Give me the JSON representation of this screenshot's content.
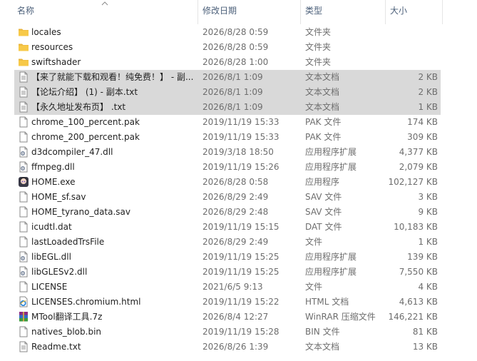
{
  "columns": {
    "name": "名称",
    "modified": "修改日期",
    "type": "类型",
    "size": "大小"
  },
  "files": [
    {
      "name": "locales",
      "modified": "2026/8/28 0:59",
      "type": "文件夹",
      "size": "",
      "icon": "folder-icon",
      "selected": false
    },
    {
      "name": "resources",
      "modified": "2026/8/28 0:59",
      "type": "文件夹",
      "size": "",
      "icon": "folder-icon",
      "selected": false
    },
    {
      "name": "swiftshader",
      "modified": "2026/8/28 1:00",
      "type": "文件夹",
      "size": "",
      "icon": "folder-icon",
      "selected": false
    },
    {
      "name": "【来了就能下载和观看！纯免费！】 - 副...",
      "modified": "2026/8/1 1:09",
      "type": "文本文档",
      "size": "2 KB",
      "icon": "text-file-icon",
      "selected": true
    },
    {
      "name": "【论坛介绍】 (1) - 副本.txt",
      "modified": "2026/8/1 1:09",
      "type": "文本文档",
      "size": "2 KB",
      "icon": "text-file-icon",
      "selected": true
    },
    {
      "name": "【永久地址发布页】 .txt",
      "modified": "2026/8/1 1:09",
      "type": "文本文档",
      "size": "1 KB",
      "icon": "text-file-icon",
      "selected": true
    },
    {
      "name": "chrome_100_percent.pak",
      "modified": "2019/11/19 15:33",
      "type": "PAK 文件",
      "size": "174 KB",
      "icon": "file-icon",
      "selected": false
    },
    {
      "name": "chrome_200_percent.pak",
      "modified": "2019/11/19 15:33",
      "type": "PAK 文件",
      "size": "309 KB",
      "icon": "file-icon",
      "selected": false
    },
    {
      "name": "d3dcompiler_47.dll",
      "modified": "2019/3/18 18:50",
      "type": "应用程序扩展",
      "size": "4,377 KB",
      "icon": "dll-icon",
      "selected": false
    },
    {
      "name": "ffmpeg.dll",
      "modified": "2019/11/19 15:26",
      "type": "应用程序扩展",
      "size": "2,079 KB",
      "icon": "dll-icon",
      "selected": false
    },
    {
      "name": "HOME.exe",
      "modified": "2026/8/28 0:58",
      "type": "应用程序",
      "size": "102,127 KB",
      "icon": "app-exe-icon",
      "selected": false
    },
    {
      "name": "HOME_sf.sav",
      "modified": "2026/8/29 2:49",
      "type": "SAV 文件",
      "size": "3 KB",
      "icon": "file-icon",
      "selected": false
    },
    {
      "name": "HOME_tyrano_data.sav",
      "modified": "2026/8/29 2:48",
      "type": "SAV 文件",
      "size": "9 KB",
      "icon": "file-icon",
      "selected": false
    },
    {
      "name": "icudtl.dat",
      "modified": "2019/11/19 15:15",
      "type": "DAT 文件",
      "size": "10,183 KB",
      "icon": "file-icon",
      "selected": false
    },
    {
      "name": "lastLoadedTrsFile",
      "modified": "2026/8/29 2:49",
      "type": "文件",
      "size": "1 KB",
      "icon": "file-icon",
      "selected": false
    },
    {
      "name": "libEGL.dll",
      "modified": "2019/11/19 15:25",
      "type": "应用程序扩展",
      "size": "139 KB",
      "icon": "dll-icon",
      "selected": false
    },
    {
      "name": "libGLESv2.dll",
      "modified": "2019/11/19 15:25",
      "type": "应用程序扩展",
      "size": "7,550 KB",
      "icon": "dll-icon",
      "selected": false
    },
    {
      "name": "LICENSE",
      "modified": "2021/6/5 9:13",
      "type": "文件",
      "size": "4 KB",
      "icon": "file-icon",
      "selected": false
    },
    {
      "name": "LICENSES.chromium.html",
      "modified": "2019/11/19 15:22",
      "type": "HTML 文档",
      "size": "4,613 KB",
      "icon": "ie-html-icon",
      "selected": false
    },
    {
      "name": "MTool翻译工具.7z",
      "modified": "2026/8/4 12:27",
      "type": "WinRAR 压缩文件",
      "size": "146,221 KB",
      "icon": "winrar-archive-icon",
      "selected": false
    },
    {
      "name": "natives_blob.bin",
      "modified": "2019/11/19 15:28",
      "type": "BIN 文件",
      "size": "81 KB",
      "icon": "file-icon",
      "selected": false
    },
    {
      "name": "Readme.txt",
      "modified": "2026/8/26 1:39",
      "type": "文本文档",
      "size": "13 KB",
      "icon": "text-file-icon",
      "selected": false
    }
  ],
  "colors": {
    "selected_row": "#d9d9d9",
    "folder": "#f7c948",
    "header_text": "#4c607a"
  }
}
